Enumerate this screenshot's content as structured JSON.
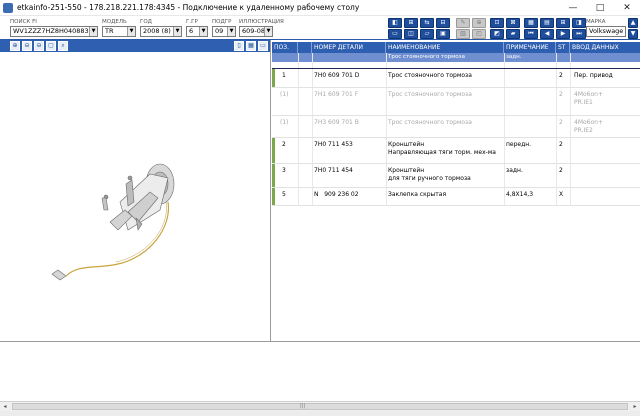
{
  "window": {
    "title": "etkainfo-251-550 - 178.218.221.178:4345 - Подключение к удаленному рабочему столу",
    "minimize": "—",
    "maximize": "□",
    "close": "✕"
  },
  "search": {
    "vin_label": "ПОИСК FI",
    "vin_value": "WV1ZZZ7HZ8H040883",
    "model_label": "МОДЕЛЬ",
    "model_value": "TR",
    "year_label": "ГОД",
    "year_value": "2008 (8)",
    "group_label": "Г.ГР",
    "group_value": "6",
    "subgroup_label": "ПОДГР",
    "subgroup_value": "09",
    "illustration_label": "ИЛЛЮСТРАЦИЯ",
    "illustration_value": "609-080",
    "brand_label": "МАРКА",
    "brand_value": "Volkswage"
  },
  "dropdown_arrow": "▼",
  "toolbar_icons": {
    "row1": [
      "◧",
      "⊞",
      "⇆",
      "⊟",
      "✎",
      "⊕",
      "⊡",
      "⊠",
      "▦",
      "▤",
      "⊞",
      "◨"
    ],
    "row2": [
      "▭",
      "◫",
      "▱",
      "▣",
      "▥",
      "◰",
      "◩",
      "▰",
      "▲",
      "▼",
      "◂",
      "▸"
    ]
  },
  "nav_icons": {
    "first": "⏮",
    "prev": "◀",
    "next": "▶",
    "last": "⏭",
    "up": "▲",
    "down": "▼"
  },
  "left_tools": [
    "⊕",
    "⊖",
    "⊖",
    "▢",
    "⌕",
    "▯",
    "▦",
    "▭"
  ],
  "grid": {
    "headers": {
      "pos": "ПОЗ.",
      "part_number": "НОМЕР ДЕТАЛИ",
      "name": "НАИМЕНОВАНИЕ",
      "note": "ПРИМЕЧАНИЕ",
      "st": "ST",
      "input": "ВВОД ДАННЫХ"
    },
    "sub_header": {
      "name": "Трос стояночного тормоза",
      "note": "задн."
    },
    "rows": [
      {
        "pos": "1",
        "part": "7H0 609 701 D",
        "name": "Трос стояночного тормоза",
        "name2": "",
        "note": "",
        "st": "2",
        "input": "Пер. привод",
        "input2": "",
        "dim": false,
        "selected": true,
        "mark": true
      },
      {
        "pos": "(1)",
        "part": "7H1 609 701 F",
        "name": "Трос стояночного тормоза",
        "name2": "",
        "note": "",
        "st": "2",
        "input": "4Mo6on+",
        "input2": "PR.IE1",
        "dim": true,
        "selected": false,
        "mark": false
      },
      {
        "pos": "(1)",
        "part": "7H3 609 701 B",
        "name": "Трос стояночного тормоза",
        "name2": "",
        "note": "",
        "st": "2",
        "input": "4Mo6on+",
        "input2": "PR.IE2",
        "dim": true,
        "selected": false,
        "mark": false
      },
      {
        "pos": "2",
        "part": "7H0 711 453",
        "name": "Кронштейн",
        "name2": "Направляющая тяги торм. мех-ма",
        "note": "передн.",
        "st": "2",
        "input": "",
        "input2": "",
        "dim": false,
        "selected": false,
        "mark": true
      },
      {
        "pos": "3",
        "part": "7H0 711 454",
        "name": "Кронштейн",
        "name2": "для тяги ручного тормоза",
        "note": "задн.",
        "st": "2",
        "input": "",
        "input2": "",
        "dim": false,
        "selected": false,
        "mark": true
      },
      {
        "pos": "5",
        "part": "N   909 236 02",
        "name": "Заклепка скрытая",
        "name2": "",
        "note": "4,8X14,3",
        "st": "X",
        "input": "",
        "input2": "",
        "dim": false,
        "selected": false,
        "mark": true
      }
    ]
  },
  "scrollbar": {
    "left_arrow": "◂",
    "right_arrow": "▸",
    "grip": "|||"
  },
  "colors": {
    "header_blue": "#2f5fb0",
    "button_blue": "#1f4f9c",
    "row_marker_green": "#7aa84a"
  }
}
